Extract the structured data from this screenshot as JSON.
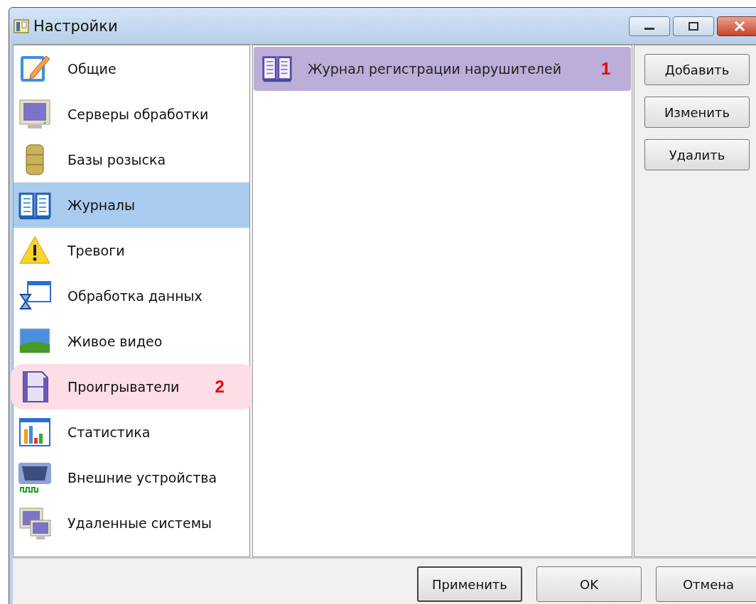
{
  "window": {
    "title": "Настройки"
  },
  "sidebar": {
    "items": [
      {
        "label": "Общие",
        "selected": false
      },
      {
        "label": "Серверы обработки",
        "selected": false
      },
      {
        "label": "Базы розыска",
        "selected": false
      },
      {
        "label": "Журналы",
        "selected": true
      },
      {
        "label": "Тревоги",
        "selected": false
      },
      {
        "label": "Обработка данных",
        "selected": false
      },
      {
        "label": "Живое видео",
        "selected": false
      },
      {
        "label": "Проигрыватели",
        "selected": false,
        "annotation": {
          "number": "2",
          "color": "#fddde6"
        }
      },
      {
        "label": "Статистика",
        "selected": false
      },
      {
        "label": "Внешние устройства",
        "selected": false
      },
      {
        "label": "Удаленные системы",
        "selected": false
      }
    ]
  },
  "list": {
    "items": [
      {
        "label": "Журнал регистрации нарушителей",
        "annotation": {
          "number": "1",
          "color": "#bcaed8"
        }
      }
    ]
  },
  "side_buttons": [
    "Добавить",
    "Изменить",
    "Удалить"
  ],
  "footer_buttons": [
    {
      "label": "Применить",
      "default": true
    },
    {
      "label": "OK",
      "default": false
    },
    {
      "label": "Отмена",
      "default": false
    }
  ]
}
